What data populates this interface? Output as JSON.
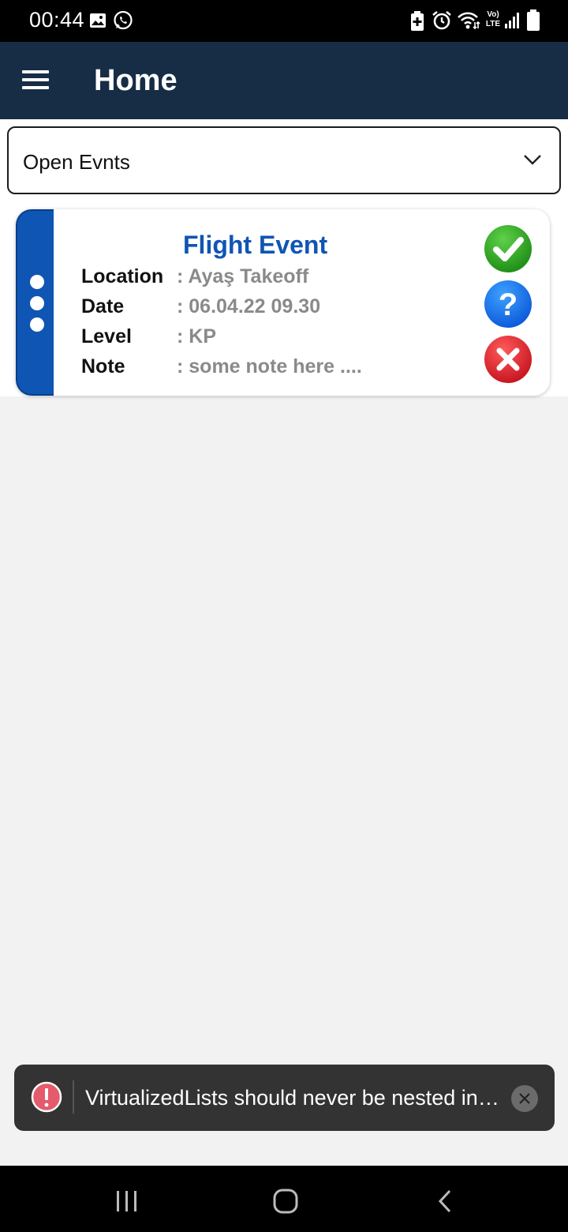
{
  "status_bar": {
    "time": "00:44",
    "left_icons": [
      "image-icon",
      "whatsapp-icon"
    ],
    "right_icons": [
      "battery-saver-icon",
      "alarm-icon",
      "wifi-icon",
      "volte-lte-icon",
      "signal-icon",
      "battery-icon"
    ],
    "network_label_top": "Vo)",
    "network_label_bottom": "LTE"
  },
  "app_bar": {
    "title": "Home",
    "background": "#172d45"
  },
  "filter_dropdown": {
    "selected": "Open Evnts"
  },
  "event_card": {
    "title": "Flight Event",
    "accent_color": "#0f55b4",
    "fields": [
      {
        "label": "Location",
        "value": ": Ayaş Takeoff"
      },
      {
        "label": "Date",
        "value": ": 06.04.22 09.30"
      },
      {
        "label": "Level",
        "value": ": KP"
      },
      {
        "label": "Note",
        "value": ": some note here ...."
      }
    ],
    "actions": [
      "approve-icon",
      "question-icon",
      "reject-icon"
    ]
  },
  "toast": {
    "message": "VirtualizedLists should never be nested in…"
  },
  "nav_bar": {
    "buttons": [
      "recent-apps",
      "home",
      "back"
    ]
  }
}
